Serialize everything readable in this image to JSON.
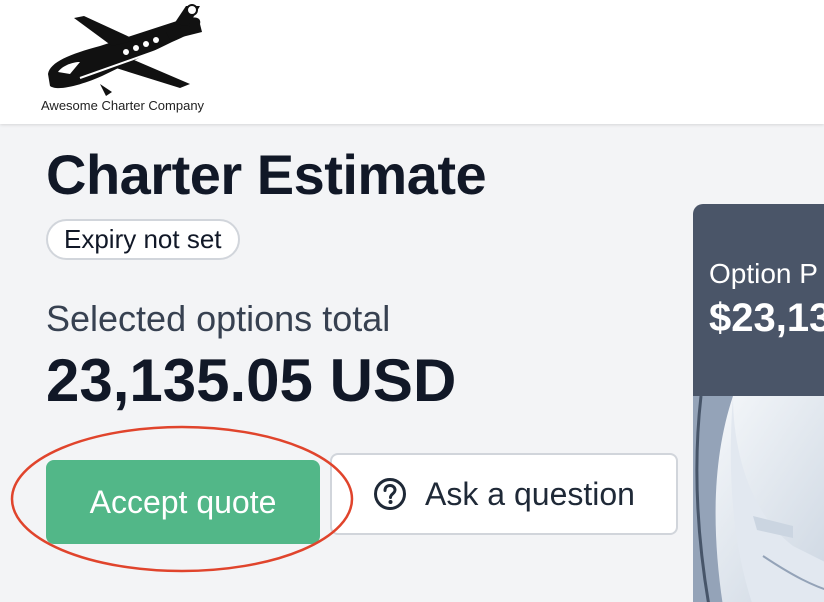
{
  "header": {
    "logo_icon": "airplane-icon",
    "company_name": "Awesome Charter Company"
  },
  "main": {
    "title": "Charter Estimate",
    "expiry_badge": "Expiry not set",
    "total_label": "Selected options total",
    "total_value": "23,135.05 USD",
    "accept_label": "Accept quote",
    "ask_label": "Ask a question",
    "ask_icon": "question-circle-icon"
  },
  "option_card": {
    "label": "Option P",
    "price": "$23,13"
  },
  "colors": {
    "accept": "#52b788",
    "card_header": "#4a5568",
    "annotation": "#e0442c"
  }
}
